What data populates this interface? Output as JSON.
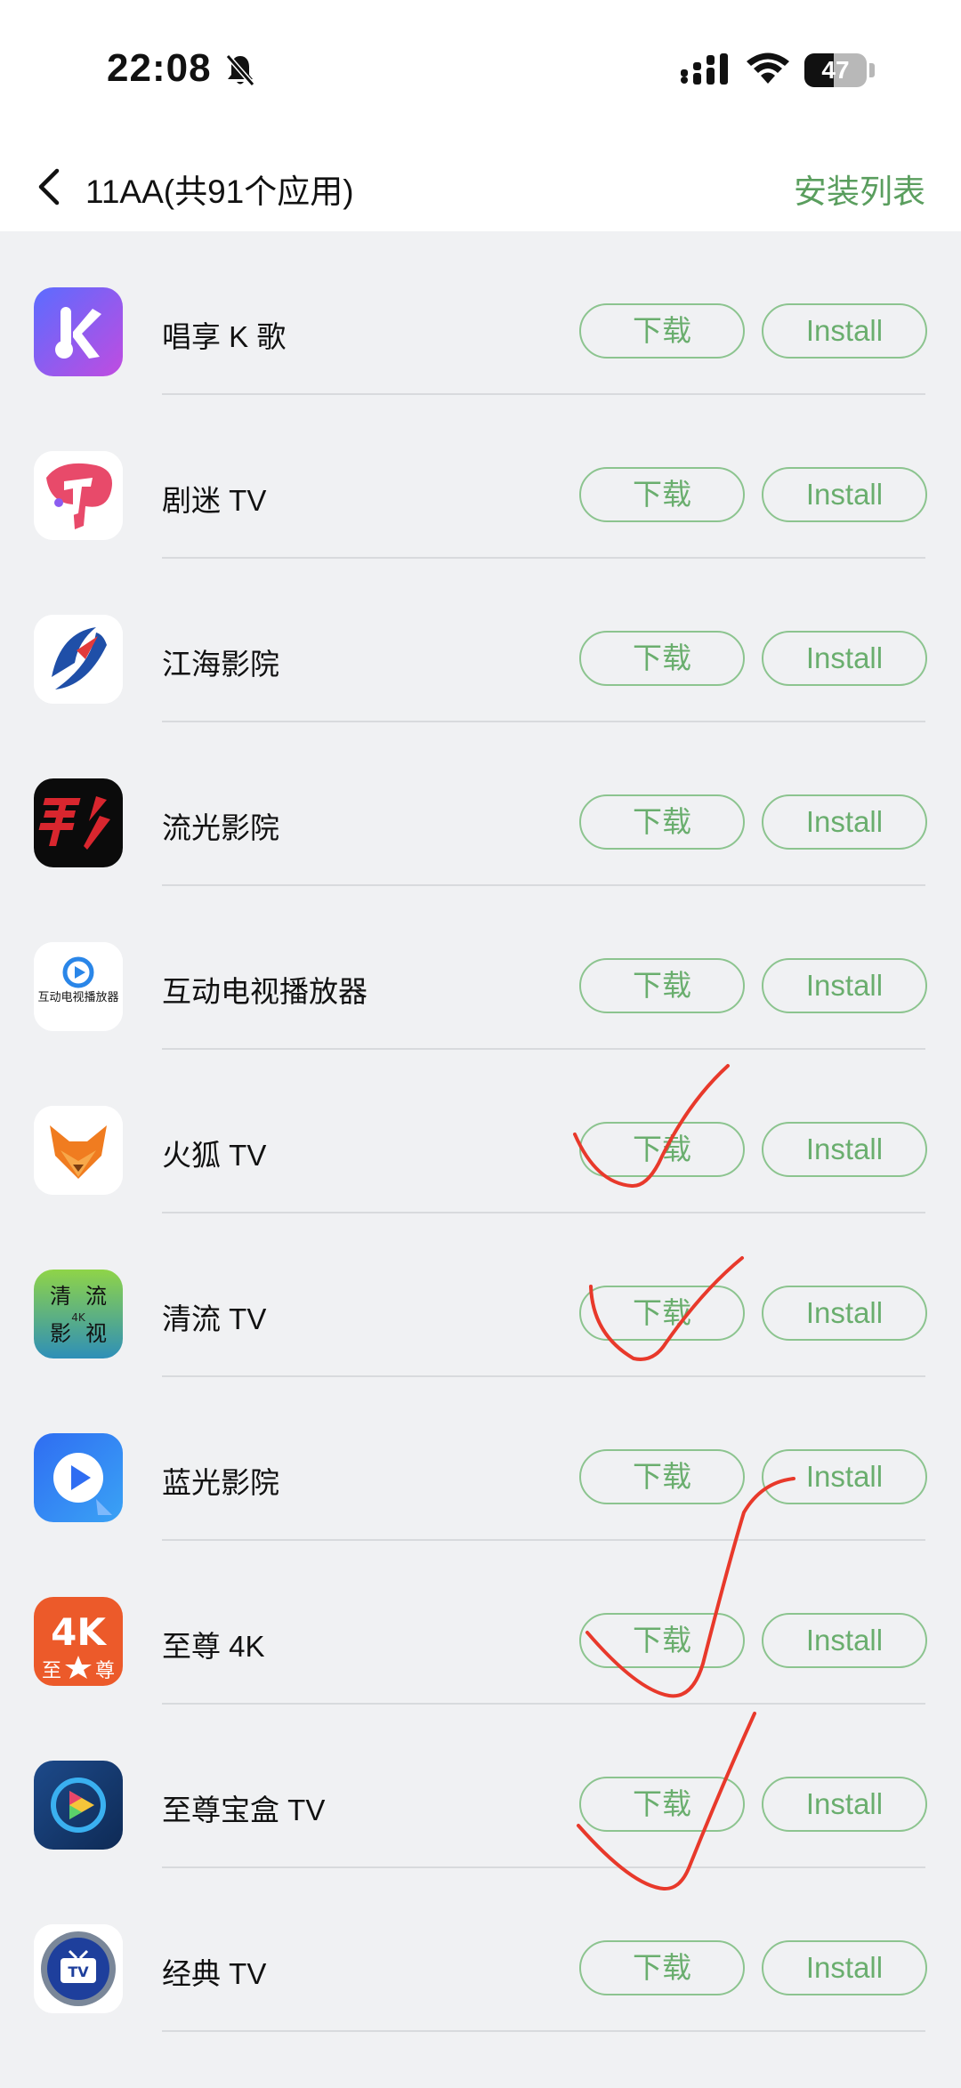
{
  "status_bar": {
    "time": "22:08",
    "battery_level": "47"
  },
  "nav": {
    "title": "11AA(共91个应用)",
    "install_list_label": "安装列表"
  },
  "apps": [
    {
      "name": "唱享 K 歌",
      "icon": "karaoke-k-icon",
      "download_label": "下载",
      "install_label": "Install"
    },
    {
      "name": "剧迷 TV",
      "icon": "jumi-tv-icon",
      "download_label": "下载",
      "install_label": "Install"
    },
    {
      "name": "江海影院",
      "icon": "jianghai-cinema-icon",
      "download_label": "下载",
      "install_label": "Install"
    },
    {
      "name": "流光影院",
      "icon": "liuguang-cinema-icon",
      "download_label": "下载",
      "install_label": "Install"
    },
    {
      "name": "互动电视播放器",
      "icon": "hudong-tv-player-icon",
      "icon_text": "互动电视播放器",
      "download_label": "下载",
      "install_label": "Install"
    },
    {
      "name": "火狐 TV",
      "icon": "fox-tv-icon",
      "download_label": "下载",
      "install_label": "Install"
    },
    {
      "name": "清流 TV",
      "icon": "qingliu-tv-icon",
      "icon_text": [
        "清",
        "流",
        "影",
        "视",
        "4K"
      ],
      "download_label": "下载",
      "install_label": "Install"
    },
    {
      "name": "蓝光影院",
      "icon": "blueray-play-icon",
      "download_label": "下载",
      "install_label": "Install"
    },
    {
      "name": "至尊 4K",
      "icon": "zhizun-4k-icon",
      "icon_text": [
        "4K",
        "至",
        "尊"
      ],
      "download_label": "下载",
      "install_label": "Install"
    },
    {
      "name": "至尊宝盒 TV",
      "icon": "zhizun-box-tv-icon",
      "download_label": "下载",
      "install_label": "Install"
    },
    {
      "name": "经典 TV",
      "icon": "classic-tv-icon",
      "icon_text": "TV",
      "download_label": "下载",
      "install_label": "Install"
    }
  ],
  "colors": {
    "accent_green": "#5a9e5e",
    "button_border": "#8cc48f",
    "annotation_red": "#e8392b",
    "background": "#f0f1f3"
  }
}
